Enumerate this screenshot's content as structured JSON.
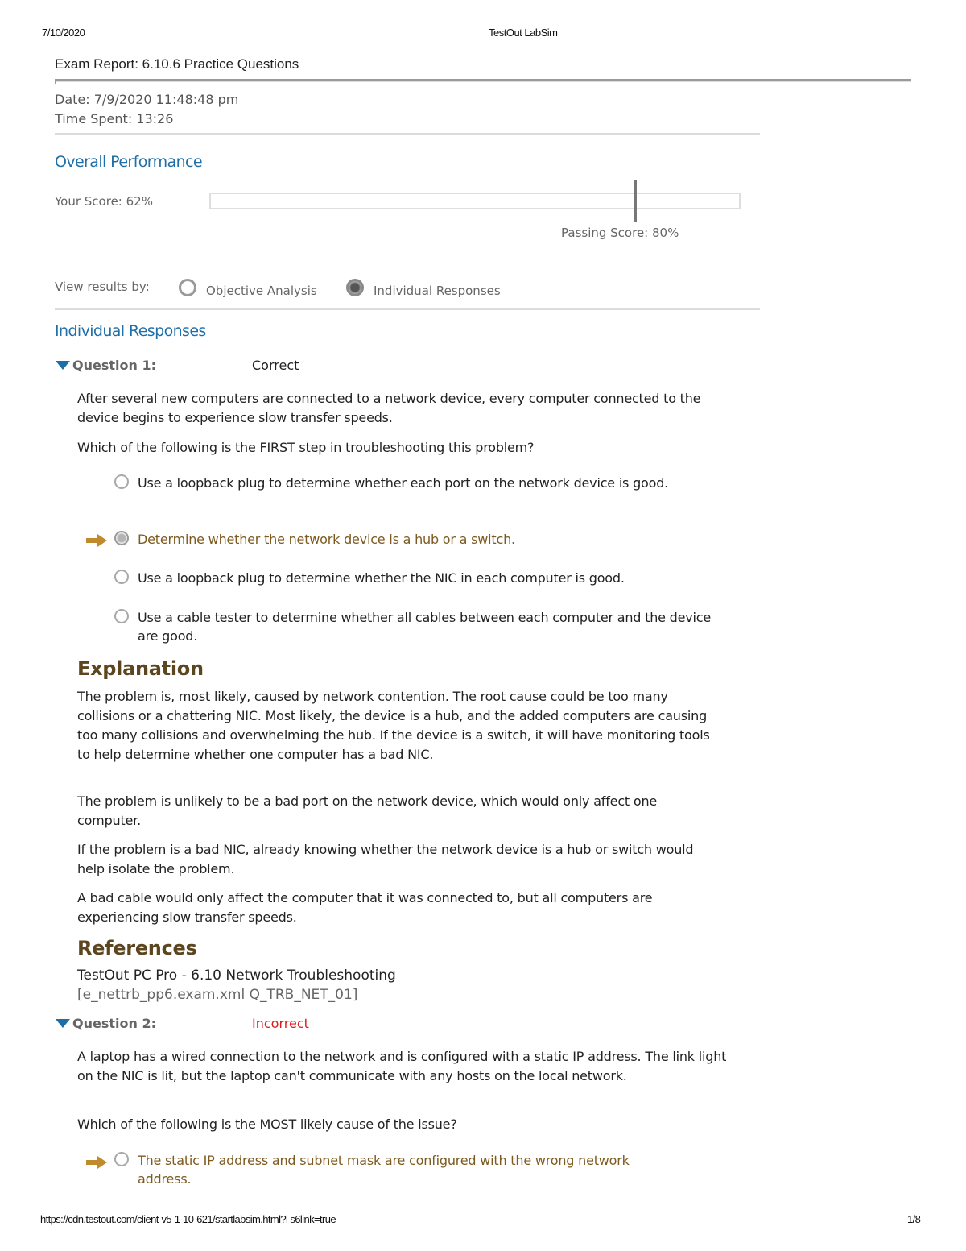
{
  "print_header": {
    "date": "7/10/2020",
    "title": "TestOut LabSim"
  },
  "exam": {
    "title": "Exam Report: 6.10.6 Practice Questions",
    "date_label": "Date: 7/9/2020 11:48:48 pm",
    "time_spent_label": "Time Spent: 13:26"
  },
  "overall": {
    "heading": "Overall Performance",
    "your_score_label": "Your Score:  62%",
    "score_percent": 62,
    "passing_score_label": "Passing Score:  80%",
    "passing_percent": 80
  },
  "view_results": {
    "label": "View results by:",
    "options": [
      {
        "label": "Objective Analysis",
        "checked": false
      },
      {
        "label": "Individual Responses",
        "checked": true
      }
    ]
  },
  "individual_responses": {
    "heading": "Individual Responses",
    "questions": [
      {
        "label": "Question 1:",
        "status": "Correct",
        "stem": [
          "After several new computers are connected to a network device, every computer connected to the device begins to experience slow transfer speeds.",
          "Which of the following is the FIRST step in troubleshooting this problem?"
        ],
        "answers": [
          {
            "text": "Use a loopback plug to determine whether each port on the network device is good.",
            "user_selected": false,
            "marked": false
          },
          {
            "text": "Determine whether the network device is a hub or a switch.",
            "user_selected": true,
            "marked": true
          },
          {
            "text": "Use a loopback plug to determine whether the NIC in each computer is good.",
            "user_selected": false,
            "marked": false
          },
          {
            "text": "Use a cable tester to determine whether all cables between each computer and the device are good.",
            "user_selected": false,
            "marked": false
          }
        ],
        "explanation_heading": "Explanation",
        "explanation": [
          "The problem is, most likely, caused by network contention. The root cause could be too many collisions or a chattering NIC. Most likely, the device is a hub, and the added computers are causing too many collisions and overwhelming the hub. If the device is a switch, it will have monitoring tools to help determine whether one computer has a bad NIC.",
          "The problem is unlikely to be a bad port on the network device, which would only affect one computer.",
          "If the problem is a bad NIC, already knowing whether the network device is a hub or switch would help isolate the problem.",
          "A bad cable would only affect the computer that it was connected to, but all computers are experiencing slow transfer speeds."
        ],
        "references_heading": "References",
        "reference": "TestOut PC Pro - 6.10 Network Troubleshooting",
        "reference_id": "[e_nettrb_pp6.exam.xml Q_TRB_NET_01]"
      },
      {
        "label": "Question 2:",
        "status": "Incorrect",
        "stem": [
          "A laptop has a wired connection to the network and is configured with a static IP address. The link light on the NIC is lit, but the laptop can't communicate with any hosts on the local network.",
          "Which of the following is the MOST likely cause of the issue?"
        ],
        "answers": [
          {
            "text": "The static IP address and subnet mask are configured with the wrong network address.",
            "user_selected": false,
            "marked": true
          }
        ]
      }
    ]
  },
  "footer": {
    "url": "https://cdn.testout.com/client-v5-1-10-621/startlabsim.html?l s6link=true",
    "page": "1/8"
  },
  "colors": {
    "section_blue": "#1f6fa8",
    "explanation_brown": "#5c4620",
    "user_answer_brown": "#7d5a1f",
    "incorrect_red": "#e01a1a",
    "arrow_gold": "#c08a2e"
  }
}
